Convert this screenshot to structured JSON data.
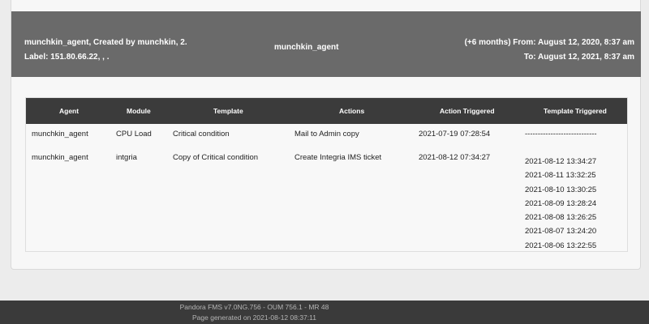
{
  "header": {
    "left_line1": "munchkin_agent, Created by munchkin, 2.",
    "left_line2": "Label: 151.80.66.22, , .",
    "center": "munchkin_agent",
    "right_line1": "(+6 months) From: August 12, 2020, 8:37 am",
    "right_line2": "To: August 12, 2021, 8:37 am"
  },
  "table": {
    "columns": [
      "Agent",
      "Module",
      "Template",
      "Actions",
      "Action Triggered",
      "Template Triggered"
    ],
    "rows": [
      {
        "agent": "munchkin_agent",
        "module": "CPU Load",
        "template": "Critical condition",
        "action": "Mail to Admin copy",
        "action_triggered": "2021-07-19 07:28:54",
        "template_triggered": "----------------------------"
      },
      {
        "agent": "munchkin_agent",
        "module": "intgria",
        "template": "Copy of Critical condition",
        "action": "Create Integria IMS ticket",
        "action_triggered": "2021-08-12 07:34:27",
        "template_triggered_list": [
          "2021-08-12 13:34:27",
          "2021-08-11 13:32:25",
          "2021-08-10 13:30:25",
          "2021-08-09 13:28:24",
          "2021-08-08 13:26:25",
          "2021-08-07 13:24:20",
          "2021-08-06 13:22:55"
        ]
      }
    ]
  },
  "footer": {
    "line1": "Pandora FMS v7.0NG.756 - OUM 756.1 - MR 48",
    "line2": "Page generated on 2021-08-12 08:37:11"
  }
}
